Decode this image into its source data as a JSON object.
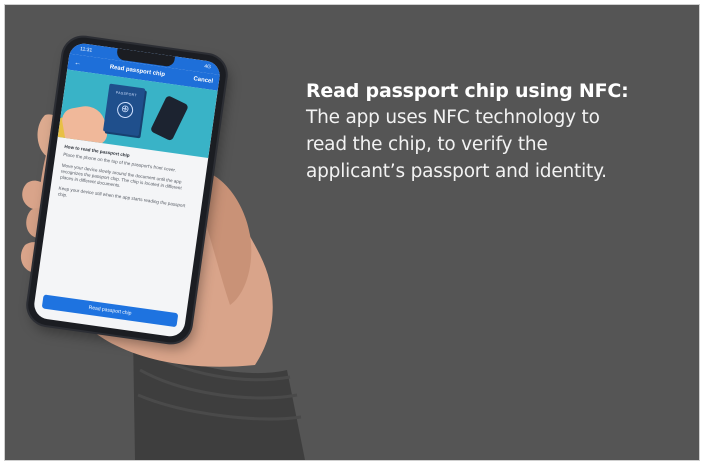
{
  "headline": {
    "title": "Read passport chip using NFC:",
    "body_lines": [
      "The app uses NFC technology to",
      "read the chip, to verify the",
      "applicant’s passport and identity."
    ]
  },
  "phone": {
    "status_time": "11:31",
    "status_signal": "4G",
    "nav": {
      "back_icon": "arrow-left-icon",
      "title": "Read passport chip",
      "cancel_label": "Cancel"
    },
    "illustration": {
      "passport_label": "PASSPORT"
    },
    "instructions": {
      "heading": "How to read the passport chip",
      "paragraphs": [
        "Place the phone on the top of the passport's front cover.",
        "Move your device slowly around the document until the app recognizes the passport chip. The chip is located in different places in different documents.",
        "Keep your device still when the app starts reading the passport chip."
      ]
    },
    "cta_label": "Read passport chip"
  },
  "colors": {
    "background": "#555555",
    "accent_blue": "#1e73e0",
    "hero_teal": "#39b3c7",
    "sleeve": "#3d3d3d"
  }
}
